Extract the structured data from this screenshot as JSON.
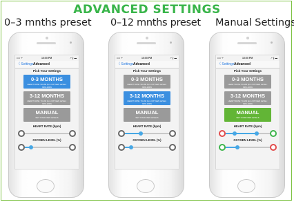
{
  "page_title": "ADVANCED SETTINGS",
  "captions": [
    "0–3 mnths preset",
    "0–12 mnths preset",
    "Manual Settings"
  ],
  "phone": {
    "status_carrier": "•••• ᯤ",
    "status_time": "10:00 PM",
    "status_battery": "↗ ∦ ▬",
    "back_label": "〈 Settings",
    "nav_title": "Advanced",
    "pick_label": "Pick Your Settings",
    "opt1_title": "0-3 MONTHS",
    "opt1_sub": "HEART RATE: 90-180 bpm OXYGEN LEVEL: 90%-100%",
    "opt2_title": "3-12 MONTHS",
    "opt2_sub": "HEART RATE: 70-160 bpm OXYGEN LEVEL: 90%-100%",
    "opt3_title": "MANUAL",
    "opt3_sub": "SET YOUR OWN LEVELS",
    "heart_label": "HEART RATE (bpm)",
    "oxygen_label": "OXYGEN LEVEL (%)"
  },
  "colors": {
    "title_green": "#39b54a",
    "selected_blue": "#3b8fe0",
    "selected_green": "#62b536",
    "unselected_gray": "#9a9a9a",
    "slider_knob": "#46a7e5",
    "dial_red": "#e14b4b",
    "dial_green": "#3cb44b"
  },
  "phones": [
    {
      "selected": "0-3 MONTHS",
      "heart_range": [
        90,
        180
      ],
      "oxygen_range": [
        90,
        100
      ]
    },
    {
      "selected": "3-12 MONTHS",
      "heart_range": [
        70,
        160
      ],
      "oxygen_range": [
        90,
        100
      ]
    },
    {
      "selected": "MANUAL",
      "heart_range": [
        null,
        null
      ],
      "oxygen_range": [
        null,
        null
      ]
    }
  ]
}
